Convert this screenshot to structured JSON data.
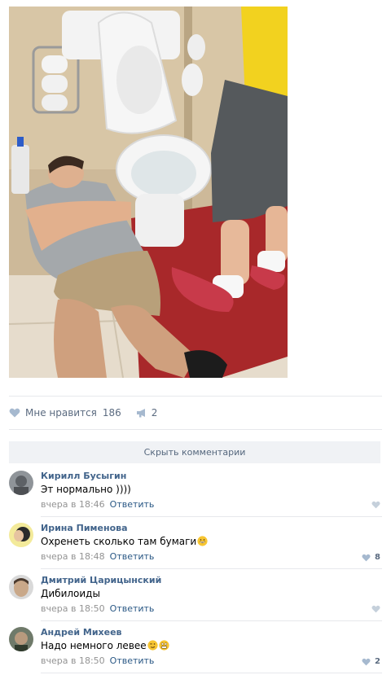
{
  "post": {
    "likes_label": "Мне нравится",
    "likes_count": "186",
    "shares_count": "2"
  },
  "comments_block": {
    "hide_label": "Скрыть комментарии",
    "reply_label": "Ответить",
    "items": [
      {
        "author": "Кирилл Бусыгин",
        "text": "Эт нормально ))))",
        "time": "вчера в 18:46",
        "likes": ""
      },
      {
        "author": "Ирина Пименова",
        "text": "Охренеть сколько там бумаги",
        "time": "вчера в 18:48",
        "likes": "8"
      },
      {
        "author": "Дмитрий Царицынский",
        "text": "Дибилоиды",
        "time": "вчера в 18:50",
        "likes": ""
      },
      {
        "author": "Андрей Михеев",
        "text": "Надо немного левее",
        "time": "вчера в 18:50",
        "likes": "2"
      }
    ]
  },
  "colors": {
    "link": "#2a5885",
    "author": "#42648b",
    "muted": "#939393",
    "icon": "#a6b9cf"
  },
  "icons": [
    "heart-icon",
    "megaphone-icon",
    "grinning-emoji",
    "wink-emoji",
    "grimace-emoji"
  ]
}
